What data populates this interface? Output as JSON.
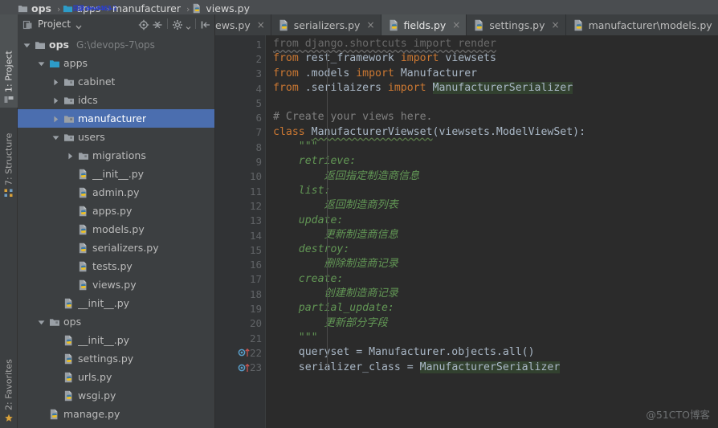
{
  "breadcrumb": {
    "items": [
      {
        "label": "ops",
        "icon": "folder-icon",
        "bold": true,
        "overlap": ""
      },
      {
        "label": "apps",
        "icon": "folder-cyan-icon",
        "bold": false,
        "overlap": "目录 dev4463-2"
      },
      {
        "label": "manufacturer",
        "icon": "",
        "bold": false,
        "overlap": ""
      },
      {
        "label": "views.py",
        "icon": "python-file-icon",
        "bold": false,
        "overlap": ""
      }
    ],
    "separator": "›"
  },
  "left_strip": {
    "tabs": [
      {
        "label": "1: Project",
        "icon": "project-icon",
        "active": true
      },
      {
        "label": "7: Structure",
        "icon": "structure-icon",
        "active": false
      },
      {
        "label": "2: Favorites",
        "icon": "favorites-icon",
        "active": false
      }
    ]
  },
  "project_panel": {
    "title": "Project",
    "dropdown_icon": "chevron-down-icon",
    "panel_icon": "project-view-icon",
    "tools": [
      {
        "name": "locate-icon",
        "title": "Select Opened File"
      },
      {
        "name": "collapse-all-icon",
        "title": "Collapse All"
      },
      {
        "name": "gear-icon",
        "title": "Settings"
      },
      {
        "name": "hide-icon",
        "title": "Hide"
      }
    ],
    "tree": [
      {
        "indent": 0,
        "arrow": "down",
        "icon": "folder-icon",
        "label": "ops",
        "bold": true,
        "path": "G:\\devops-7\\ops",
        "selected": false
      },
      {
        "indent": 1,
        "arrow": "down",
        "icon": "folder-cyan-icon",
        "label": "apps",
        "bold": false,
        "path": "",
        "selected": false
      },
      {
        "indent": 2,
        "arrow": "right",
        "icon": "module-folder-icon",
        "label": "cabinet",
        "bold": false,
        "path": "",
        "selected": false
      },
      {
        "indent": 2,
        "arrow": "right",
        "icon": "module-folder-icon",
        "label": "idcs",
        "bold": false,
        "path": "",
        "selected": false
      },
      {
        "indent": 2,
        "arrow": "right",
        "icon": "module-folder-icon",
        "label": "manufacturer",
        "bold": false,
        "path": "",
        "selected": true
      },
      {
        "indent": 2,
        "arrow": "down",
        "icon": "module-folder-icon",
        "label": "users",
        "bold": false,
        "path": "",
        "selected": false
      },
      {
        "indent": 3,
        "arrow": "right",
        "icon": "module-folder-icon",
        "label": "migrations",
        "bold": false,
        "path": "",
        "selected": false
      },
      {
        "indent": 3,
        "arrow": "none",
        "icon": "python-file-icon",
        "label": "__init__.py",
        "bold": false,
        "path": "",
        "selected": false
      },
      {
        "indent": 3,
        "arrow": "none",
        "icon": "python-file-icon",
        "label": "admin.py",
        "bold": false,
        "path": "",
        "selected": false
      },
      {
        "indent": 3,
        "arrow": "none",
        "icon": "python-file-icon",
        "label": "apps.py",
        "bold": false,
        "path": "",
        "selected": false
      },
      {
        "indent": 3,
        "arrow": "none",
        "icon": "python-file-icon",
        "label": "models.py",
        "bold": false,
        "path": "",
        "selected": false
      },
      {
        "indent": 3,
        "arrow": "none",
        "icon": "python-file-icon",
        "label": "serializers.py",
        "bold": false,
        "path": "",
        "selected": false
      },
      {
        "indent": 3,
        "arrow": "none",
        "icon": "python-file-icon",
        "label": "tests.py",
        "bold": false,
        "path": "",
        "selected": false
      },
      {
        "indent": 3,
        "arrow": "none",
        "icon": "python-file-icon",
        "label": "views.py",
        "bold": false,
        "path": "",
        "selected": false
      },
      {
        "indent": 2,
        "arrow": "none",
        "icon": "python-file-icon",
        "label": "__init__.py",
        "bold": false,
        "path": "",
        "selected": false
      },
      {
        "indent": 1,
        "arrow": "down",
        "icon": "module-folder-icon",
        "label": "ops",
        "bold": false,
        "path": "",
        "selected": false
      },
      {
        "indent": 2,
        "arrow": "none",
        "icon": "python-file-icon",
        "label": "__init__.py",
        "bold": false,
        "path": "",
        "selected": false
      },
      {
        "indent": 2,
        "arrow": "none",
        "icon": "python-file-icon",
        "label": "settings.py",
        "bold": false,
        "path": "",
        "selected": false
      },
      {
        "indent": 2,
        "arrow": "none",
        "icon": "python-file-icon",
        "label": "urls.py",
        "bold": false,
        "path": "",
        "selected": false
      },
      {
        "indent": 2,
        "arrow": "none",
        "icon": "python-file-icon",
        "label": "wsgi.py",
        "bold": false,
        "path": "",
        "selected": false
      },
      {
        "indent": 1,
        "arrow": "none",
        "icon": "python-file-icon",
        "label": "manage.py",
        "bold": false,
        "path": "",
        "selected": false
      }
    ]
  },
  "editor_tabs": {
    "close_glyph": "×",
    "items": [
      {
        "label": "ews.py",
        "icon": "",
        "active": false,
        "clipped": true
      },
      {
        "label": "serializers.py",
        "icon": "python-file-icon",
        "active": false,
        "clipped": false
      },
      {
        "label": "fields.py",
        "icon": "python-file-icon",
        "active": true,
        "clipped": false
      },
      {
        "label": "settings.py",
        "icon": "python-file-icon",
        "active": false,
        "clipped": false
      },
      {
        "label": "manufacturer\\models.py",
        "icon": "python-file-icon",
        "active": false,
        "clipped": false
      },
      {
        "label": "",
        "icon": "python-file-icon",
        "active": false,
        "clipped": false
      }
    ]
  },
  "editor": {
    "lines": [
      {
        "n": "1",
        "marker": "",
        "fold": "minus",
        "html": "<span class=\"dim wavy\">from django.shortcuts import render</span>"
      },
      {
        "n": "2",
        "marker": "",
        "fold": "",
        "html": "<span class=\"kw\">from</span> rest_framework <span class=\"kw\">import</span> viewsets"
      },
      {
        "n": "3",
        "marker": "",
        "fold": "",
        "html": "<span class=\"kw\">from</span> .models <span class=\"kw\">import</span> Manufacturer"
      },
      {
        "n": "4",
        "marker": "",
        "fold": "end",
        "html": "<span class=\"kw\">from</span> .serilaizers <span class=\"kw\">import</span> <span class=\"hl\">ManufacturerSerializer</span>"
      },
      {
        "n": "5",
        "marker": "",
        "fold": "",
        "html": ""
      },
      {
        "n": "6",
        "marker": "",
        "fold": "",
        "html": "<span class=\"cmt\"># Create your views here.</span>"
      },
      {
        "n": "7",
        "marker": "",
        "fold": "minus",
        "html": "<span class=\"kw\">class</span> <span class=\"wavy-g\">ManufacturerViewset</span>(viewsets.ModelViewSet):"
      },
      {
        "n": "8",
        "marker": "",
        "fold": "minus",
        "html": "    <span class=\"doc\">\"\"\"</span>"
      },
      {
        "n": "9",
        "marker": "",
        "fold": "",
        "html": "    <span class=\"doc\">retrieve:</span>"
      },
      {
        "n": "10",
        "marker": "",
        "fold": "",
        "html": "        <span class=\"doc\">返回指定制造商信息</span>"
      },
      {
        "n": "11",
        "marker": "",
        "fold": "",
        "html": "    <span class=\"doc\">list:</span>"
      },
      {
        "n": "12",
        "marker": "",
        "fold": "",
        "html": "        <span class=\"doc\">返回制造商列表</span>"
      },
      {
        "n": "13",
        "marker": "",
        "fold": "",
        "html": "    <span class=\"doc\">update:</span>"
      },
      {
        "n": "14",
        "marker": "",
        "fold": "",
        "html": "        <span class=\"doc\">更新制造商信息</span>"
      },
      {
        "n": "15",
        "marker": "",
        "fold": "",
        "html": "    <span class=\"doc\">destroy:</span>"
      },
      {
        "n": "16",
        "marker": "",
        "fold": "",
        "html": "        <span class=\"doc\">删除制造商记录</span>"
      },
      {
        "n": "17",
        "marker": "",
        "fold": "",
        "html": "    <span class=\"doc\">create:</span>"
      },
      {
        "n": "18",
        "marker": "",
        "fold": "",
        "html": "        <span class=\"doc\">创建制造商记录</span>"
      },
      {
        "n": "19",
        "marker": "",
        "fold": "",
        "html": "    <span class=\"doc\">partial_update:</span>"
      },
      {
        "n": "20",
        "marker": "",
        "fold": "",
        "html": "        <span class=\"doc\">更新部分字段</span>"
      },
      {
        "n": "21",
        "marker": "",
        "fold": "end",
        "html": "    <span class=\"doc\">\"\"\"</span>"
      },
      {
        "n": "22",
        "marker": "override",
        "fold": "",
        "html": "    queryset = Manufacturer.objects.all()"
      },
      {
        "n": "23",
        "marker": "override",
        "fold": "end",
        "html": "    serializer_class = <span class=\"hl\">ManufacturerSerializer</span>"
      }
    ]
  },
  "watermark": {
    "text": "@51CTO博客"
  },
  "colors": {
    "panel_bg": "#3c3f41",
    "editor_bg": "#2b2b2b",
    "gutter_bg": "#313335",
    "selection": "#4b6eaf",
    "keyword": "#cc7832",
    "docstring": "#629755",
    "comment": "#808080",
    "text": "#a9b7c6",
    "highlight": "#32412f"
  }
}
